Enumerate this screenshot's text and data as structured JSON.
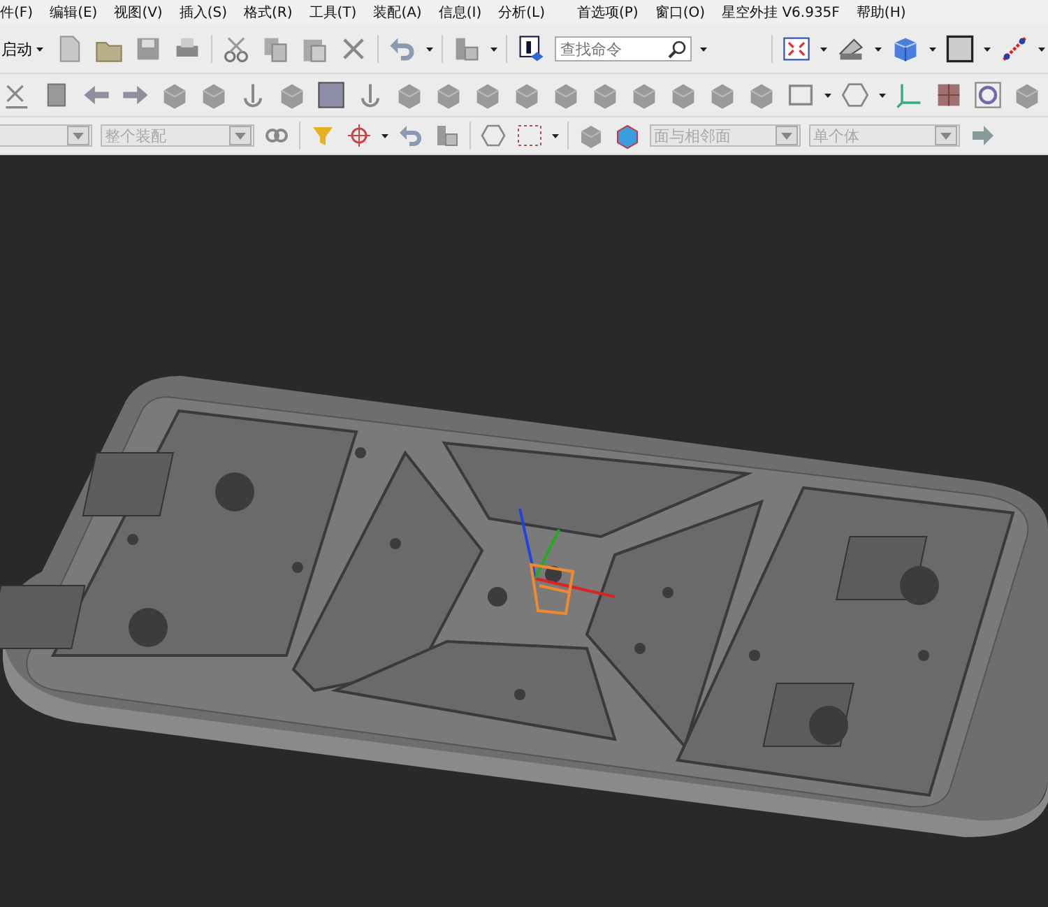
{
  "menu": [
    {
      "label": "件(F)"
    },
    {
      "label": "编辑(E)"
    },
    {
      "label": "视图(V)"
    },
    {
      "label": "插入(S)"
    },
    {
      "label": "格式(R)"
    },
    {
      "label": "工具(T)"
    },
    {
      "label": "装配(A)"
    },
    {
      "label": "信息(I)"
    },
    {
      "label": "分析(L)"
    },
    {
      "label": "首选项(P)"
    },
    {
      "label": "窗口(O)"
    },
    {
      "label": "星空外挂 V6.935F"
    },
    {
      "label": "帮助(H)"
    }
  ],
  "toolbar": {
    "start_button": "启动",
    "search": {
      "placeholder": "查找命令"
    }
  },
  "selection_bar": {
    "filters": [
      {
        "disabled": true
      },
      {
        "value": "整个装配",
        "disabled": true
      },
      {
        "value": "面与相邻面",
        "disabled": true
      },
      {
        "value": "单个体",
        "disabled": true
      }
    ]
  }
}
